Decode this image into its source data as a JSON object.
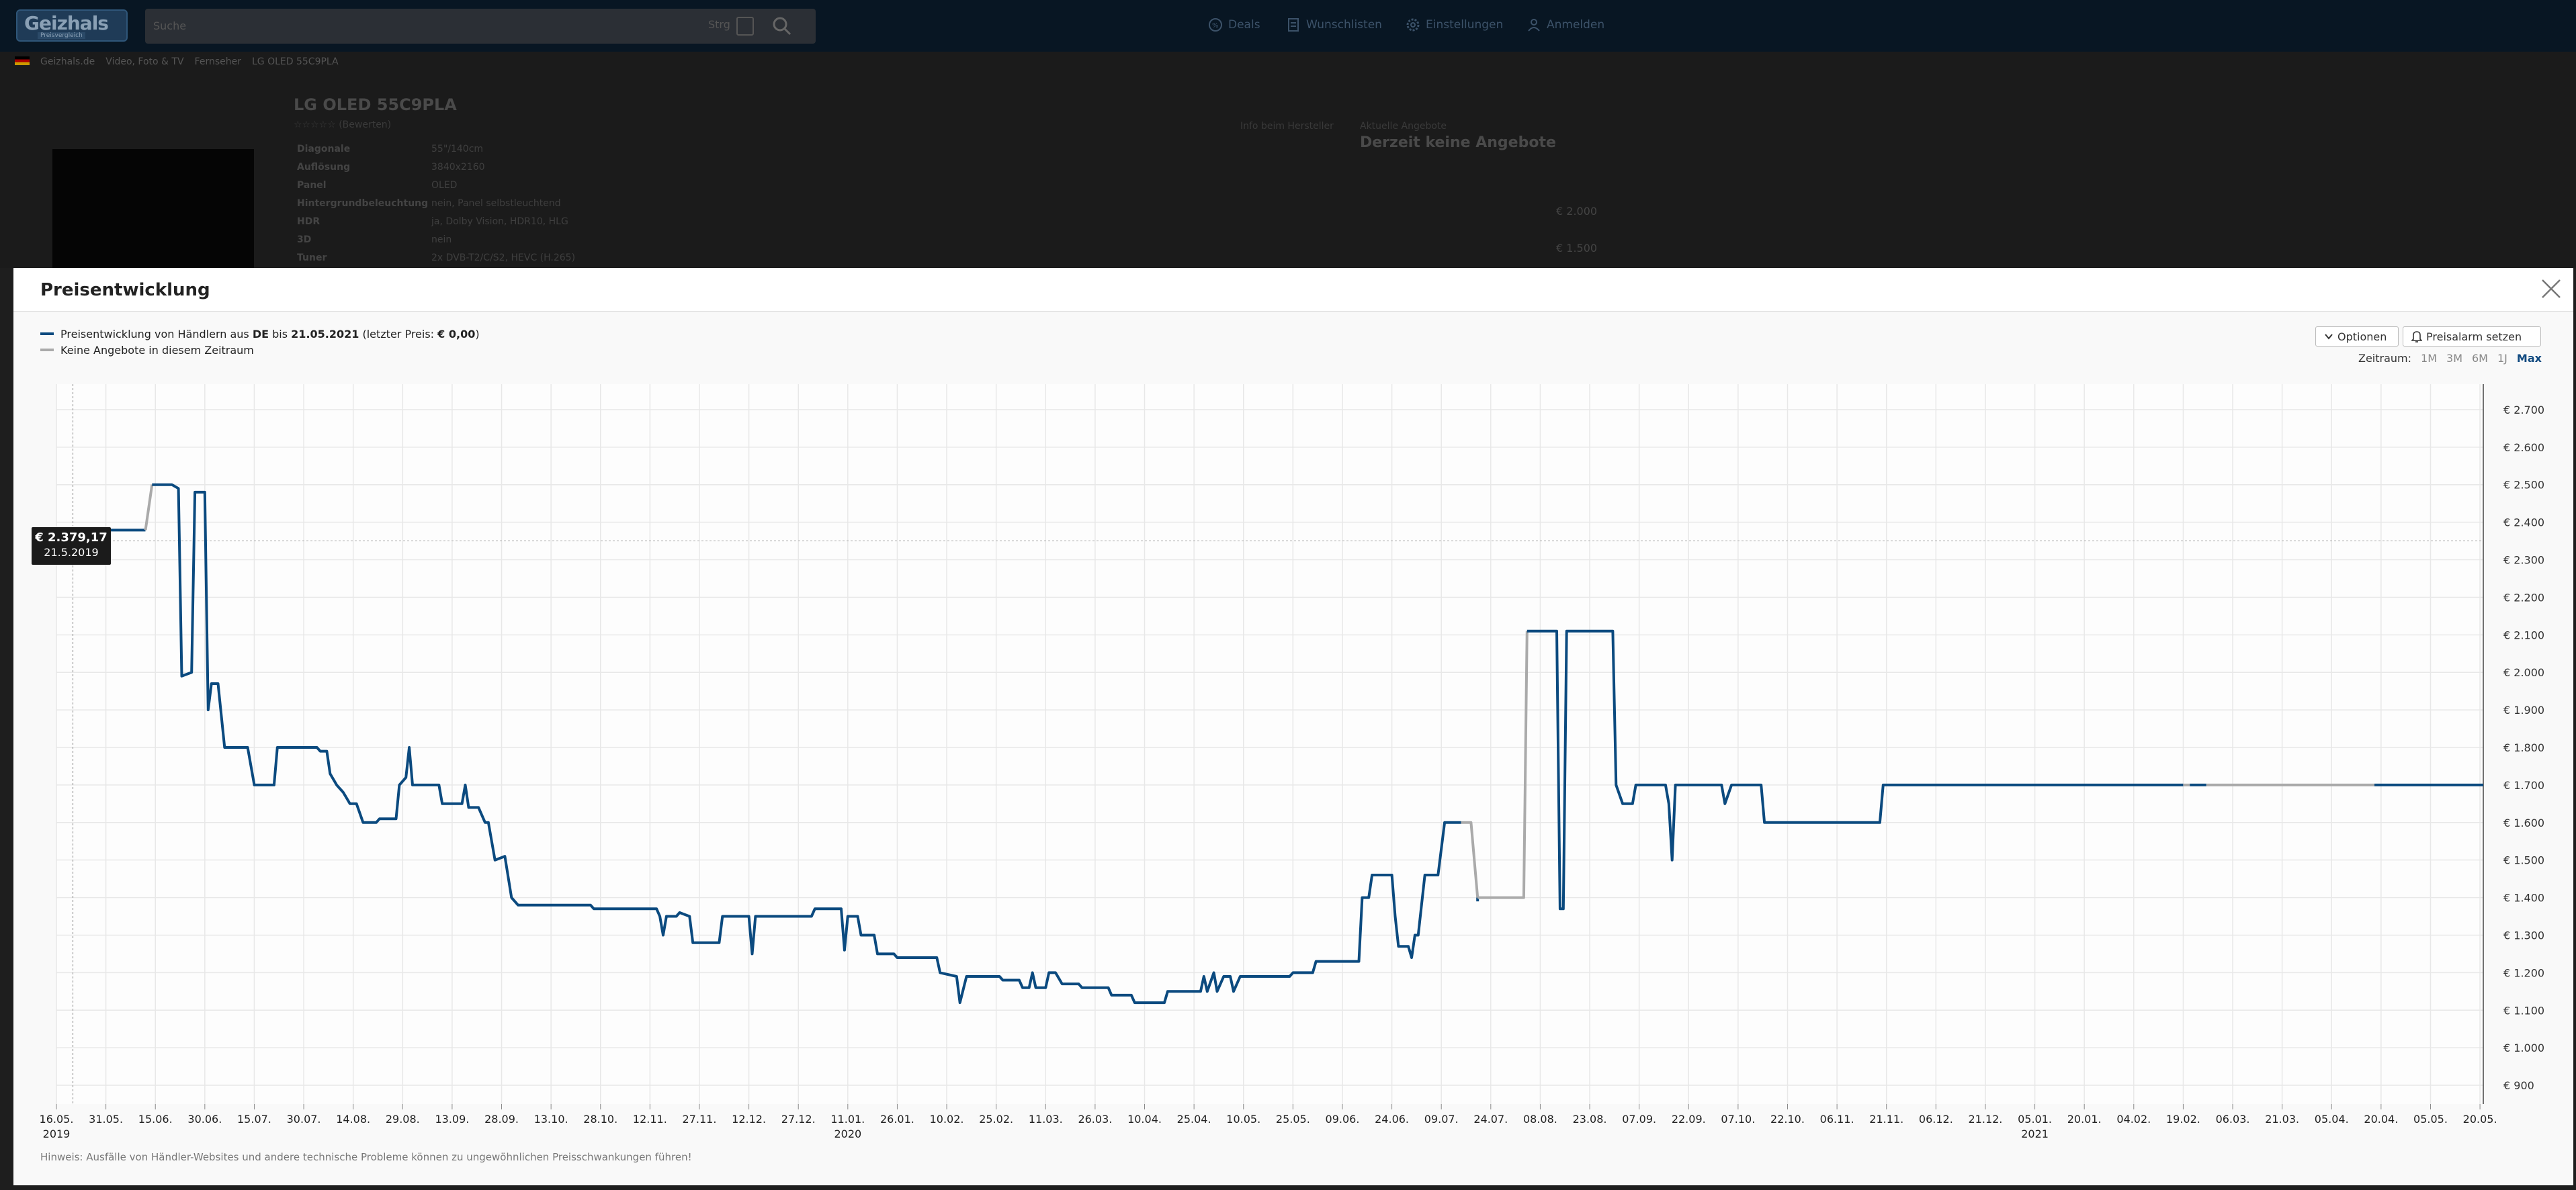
{
  "header": {
    "logo_text": "Geizhals",
    "logo_sub": "Preisvergleich",
    "search_placeholder": "Suche",
    "search_key": "Strg",
    "nav": [
      {
        "label": "Deals",
        "icon": "deals-icon"
      },
      {
        "label": "Wunschlisten",
        "icon": "list-icon"
      },
      {
        "label": "Einstellungen",
        "icon": "gear-icon"
      },
      {
        "label": "Anmelden",
        "icon": "user-icon"
      }
    ]
  },
  "breadcrumb": [
    "Geizhals.de",
    "Video, Foto & TV",
    "Fernseher",
    "LG OLED 55C9PLA"
  ],
  "product": {
    "title": "LG OLED 55C9PLA",
    "rating_text": "☆☆☆☆☆ (Bewerten)",
    "specs": [
      {
        "k": "Diagonale",
        "v": "55\"/140cm"
      },
      {
        "k": "Auflösung",
        "v": "3840x2160"
      },
      {
        "k": "Panel",
        "v": "OLED"
      },
      {
        "k": "Hintergrundbeleuchtung",
        "v": "nein, Panel selbstleuchtend"
      },
      {
        "k": "HDR",
        "v": "ja, Dolby Vision, HDR10, HLG"
      },
      {
        "k": "3D",
        "v": "nein"
      },
      {
        "k": "Tuner",
        "v": "2x DVB-T2/C/S2, HEVC (H.265)"
      }
    ],
    "maker_link": "Info beim Hersteller",
    "offer_label": "Aktuelle Angebote",
    "offer_title": "Derzeit keine Angebote",
    "offer_prices": [
      "€ 2.000",
      "€ 1.500"
    ]
  },
  "modal": {
    "title": "Preisentwicklung",
    "legend": [
      {
        "prefix": "Preisentwicklung von Händlern aus ",
        "country": "DE",
        "mid": " bis ",
        "date": "21.05.2021",
        "suffix_a": " (letzter Preis: ",
        "last_price": "€ 0,00",
        "suffix_b": ")",
        "color": "#0b4a7f"
      },
      {
        "text": "Keine Angebote in diesem Zeitraum",
        "color": "#aaaaaa"
      }
    ],
    "options_label": "Optionen",
    "alarm_label": "Preisalarm setzen",
    "range_label": "Zeitraum:",
    "ranges": [
      "1M",
      "3M",
      "6M",
      "1J",
      "Max"
    ],
    "active_range": "Max",
    "tooltip": {
      "value": "€ 2.379,17",
      "date": "21.5.2019"
    },
    "hint": "Hinweis: Ausfälle von Händler-Websites und andere technische Probleme können zu ungewöhnlichen Preisschwankungen führen!"
  },
  "chart_data": {
    "type": "line",
    "title": "",
    "xlabel": "",
    "ylabel": "",
    "ylim": [
      850,
      2750
    ],
    "y_ticks": [
      "€ 900",
      "€ 1.000",
      "€ 1.100",
      "€ 1.200",
      "€ 1.300",
      "€ 1.400",
      "€ 1.500",
      "€ 1.600",
      "€ 1.700",
      "€ 1.800",
      "€ 1.900",
      "€ 2.000",
      "€ 2.100",
      "€ 2.200",
      "€ 2.300",
      "€ 2.400",
      "€ 2.500",
      "€ 2.600",
      "€ 2.700"
    ],
    "y_tick_values": [
      900,
      1000,
      1100,
      1200,
      1300,
      1400,
      1500,
      1600,
      1700,
      1800,
      1900,
      2000,
      2100,
      2200,
      2300,
      2400,
      2500,
      2600,
      2700
    ],
    "x_ticks": [
      "16.05.",
      "31.05.",
      "15.06.",
      "30.06.",
      "15.07.",
      "30.07.",
      "14.08.",
      "29.08.",
      "13.09.",
      "28.09.",
      "13.10.",
      "28.10.",
      "12.11.",
      "27.11.",
      "12.12.",
      "27.12.",
      "11.01.",
      "26.01.",
      "10.02.",
      "25.02.",
      "11.03.",
      "26.03.",
      "10.04.",
      "25.04.",
      "10.05.",
      "25.05.",
      "09.06.",
      "24.06.",
      "09.07.",
      "24.07.",
      "08.08.",
      "23.08.",
      "07.09.",
      "22.09.",
      "07.10.",
      "22.10.",
      "06.11.",
      "21.11.",
      "06.12.",
      "21.12.",
      "05.01.",
      "20.01.",
      "04.02.",
      "19.02.",
      "06.03.",
      "21.03.",
      "05.04.",
      "20.04.",
      "05.05.",
      "20.05."
    ],
    "x_tick_years": {
      "0": "2019",
      "16": "2020",
      "40": "2021"
    },
    "x_start": "2019-05-16",
    "x_end": "2021-05-21",
    "series": [
      {
        "color": "#0b4a7f",
        "points": [
          [
            "2019-05-16",
            2379
          ],
          [
            "2019-06-12",
            2379
          ]
        ]
      },
      {
        "color": "#aaaaaa",
        "points": [
          [
            "2019-06-12",
            2379
          ],
          [
            "2019-06-14",
            2500
          ]
        ]
      },
      {
        "color": "#0b4a7f",
        "points": [
          [
            "2019-06-14",
            2500
          ],
          [
            "2019-06-20",
            2500
          ],
          [
            "2019-06-22",
            2490
          ],
          [
            "2019-06-23",
            1990
          ],
          [
            "2019-06-26",
            2000
          ],
          [
            "2019-06-27",
            2480
          ],
          [
            "2019-06-30",
            2480
          ],
          [
            "2019-07-01",
            1900
          ],
          [
            "2019-07-02",
            1970
          ],
          [
            "2019-07-04",
            1970
          ],
          [
            "2019-07-06",
            1800
          ],
          [
            "2019-07-13",
            1800
          ],
          [
            "2019-07-15",
            1700
          ],
          [
            "2019-07-21",
            1700
          ],
          [
            "2019-07-22",
            1800
          ],
          [
            "2019-08-03",
            1800
          ],
          [
            "2019-08-04",
            1790
          ],
          [
            "2019-08-06",
            1790
          ],
          [
            "2019-08-07",
            1730
          ],
          [
            "2019-08-09",
            1700
          ],
          [
            "2019-08-11",
            1680
          ],
          [
            "2019-08-13",
            1650
          ],
          [
            "2019-08-15",
            1650
          ],
          [
            "2019-08-17",
            1600
          ],
          [
            "2019-08-21",
            1600
          ],
          [
            "2019-08-22",
            1610
          ],
          [
            "2019-08-27",
            1610
          ],
          [
            "2019-08-28",
            1700
          ],
          [
            "2019-08-30",
            1720
          ],
          [
            "2019-08-31",
            1800
          ],
          [
            "2019-09-01",
            1700
          ],
          [
            "2019-09-09",
            1700
          ],
          [
            "2019-09-10",
            1650
          ],
          [
            "2019-09-16",
            1650
          ],
          [
            "2019-09-17",
            1700
          ],
          [
            "2019-09-18",
            1640
          ],
          [
            "2019-09-21",
            1640
          ],
          [
            "2019-09-23",
            1600
          ],
          [
            "2019-09-24",
            1600
          ],
          [
            "2019-09-26",
            1500
          ],
          [
            "2019-09-29",
            1510
          ],
          [
            "2019-10-01",
            1400
          ],
          [
            "2019-10-03",
            1380
          ],
          [
            "2019-10-25",
            1380
          ],
          [
            "2019-10-26",
            1370
          ],
          [
            "2019-11-14",
            1370
          ],
          [
            "2019-11-15",
            1350
          ],
          [
            "2019-11-16",
            1300
          ],
          [
            "2019-11-17",
            1350
          ],
          [
            "2019-11-20",
            1350
          ],
          [
            "2019-11-21",
            1360
          ],
          [
            "2019-11-24",
            1350
          ],
          [
            "2019-11-25",
            1280
          ],
          [
            "2019-12-03",
            1280
          ],
          [
            "2019-12-04",
            1350
          ],
          [
            "2019-12-12",
            1350
          ],
          [
            "2019-12-13",
            1250
          ],
          [
            "2019-12-14",
            1350
          ],
          [
            "2019-12-31",
            1350
          ],
          [
            "2020-01-01",
            1370
          ],
          [
            "2020-01-09",
            1370
          ],
          [
            "2020-01-10",
            1260
          ],
          [
            "2020-01-11",
            1350
          ],
          [
            "2020-01-14",
            1350
          ],
          [
            "2020-01-15",
            1300
          ],
          [
            "2020-01-19",
            1300
          ],
          [
            "2020-01-20",
            1250
          ],
          [
            "2020-01-25",
            1250
          ],
          [
            "2020-01-26",
            1240
          ],
          [
            "2020-02-07",
            1240
          ],
          [
            "2020-02-08",
            1200
          ],
          [
            "2020-02-13",
            1190
          ],
          [
            "2020-02-14",
            1120
          ],
          [
            "2020-02-16",
            1190
          ],
          [
            "2020-02-26",
            1190
          ],
          [
            "2020-02-27",
            1180
          ],
          [
            "2020-03-03",
            1180
          ],
          [
            "2020-03-04",
            1160
          ],
          [
            "2020-03-06",
            1160
          ],
          [
            "2020-03-07",
            1200
          ],
          [
            "2020-03-08",
            1160
          ],
          [
            "2020-03-11",
            1160
          ],
          [
            "2020-03-12",
            1200
          ],
          [
            "2020-03-14",
            1200
          ],
          [
            "2020-03-16",
            1170
          ],
          [
            "2020-03-21",
            1170
          ],
          [
            "2020-03-22",
            1160
          ],
          [
            "2020-03-30",
            1160
          ],
          [
            "2020-03-31",
            1140
          ],
          [
            "2020-04-06",
            1140
          ],
          [
            "2020-04-07",
            1120
          ],
          [
            "2020-04-16",
            1120
          ],
          [
            "2020-04-17",
            1150
          ],
          [
            "2020-04-27",
            1150
          ],
          [
            "2020-04-28",
            1190
          ],
          [
            "2020-04-29",
            1150
          ],
          [
            "2020-05-01",
            1200
          ],
          [
            "2020-05-02",
            1150
          ],
          [
            "2020-05-04",
            1190
          ],
          [
            "2020-05-06",
            1190
          ],
          [
            "2020-05-07",
            1150
          ],
          [
            "2020-05-09",
            1190
          ],
          [
            "2020-05-24",
            1190
          ],
          [
            "2020-05-25",
            1200
          ],
          [
            "2020-05-31",
            1200
          ],
          [
            "2020-06-01",
            1230
          ],
          [
            "2020-06-14",
            1230
          ],
          [
            "2020-06-15",
            1400
          ],
          [
            "2020-06-17",
            1400
          ],
          [
            "2020-06-18",
            1460
          ],
          [
            "2020-06-24",
            1460
          ],
          [
            "2020-06-25",
            1350
          ],
          [
            "2020-06-26",
            1270
          ],
          [
            "2020-06-29",
            1270
          ],
          [
            "2020-06-30",
            1240
          ],
          [
            "2020-07-01",
            1300
          ],
          [
            "2020-07-02",
            1300
          ],
          [
            "2020-07-04",
            1460
          ],
          [
            "2020-07-08",
            1460
          ],
          [
            "2020-07-10",
            1600
          ],
          [
            "2020-07-15",
            1600
          ]
        ]
      },
      {
        "color": "#aaaaaa",
        "points": [
          [
            "2020-07-15",
            1600
          ],
          [
            "2020-07-18",
            1600
          ],
          [
            "2020-07-20",
            1400
          ]
        ]
      },
      {
        "color": "#0b4a7f",
        "points": [
          [
            "2020-07-20",
            1400
          ],
          [
            "2020-07-20",
            1390
          ]
        ]
      },
      {
        "color": "#aaaaaa",
        "points": [
          [
            "2020-07-20",
            1400
          ],
          [
            "2020-08-03",
            1400
          ],
          [
            "2020-08-04",
            2110
          ]
        ]
      },
      {
        "color": "#0b4a7f",
        "points": [
          [
            "2020-08-04",
            2110
          ],
          [
            "2020-08-13",
            2110
          ],
          [
            "2020-08-14",
            1370
          ],
          [
            "2020-08-15",
            1370
          ],
          [
            "2020-08-16",
            2110
          ],
          [
            "2020-08-30",
            2110
          ],
          [
            "2020-08-31",
            1700
          ],
          [
            "2020-09-02",
            1650
          ],
          [
            "2020-09-05",
            1650
          ],
          [
            "2020-09-06",
            1700
          ],
          [
            "2020-09-15",
            1700
          ],
          [
            "2020-09-16",
            1650
          ],
          [
            "2020-09-17",
            1500
          ],
          [
            "2020-09-18",
            1700
          ],
          [
            "2020-10-02",
            1700
          ],
          [
            "2020-10-03",
            1650
          ],
          [
            "2020-10-05",
            1700
          ],
          [
            "2020-10-14",
            1700
          ],
          [
            "2020-10-15",
            1600
          ],
          [
            "2020-11-19",
            1600
          ],
          [
            "2020-11-20",
            1700
          ],
          [
            "2021-02-19",
            1700
          ]
        ]
      },
      {
        "color": "#aaaaaa",
        "points": [
          [
            "2021-02-19",
            1700
          ],
          [
            "2021-02-21",
            1700
          ]
        ]
      },
      {
        "color": "#0b4a7f",
        "points": [
          [
            "2021-02-21",
            1700
          ],
          [
            "2021-02-26",
            1700
          ]
        ]
      },
      {
        "color": "#aaaaaa",
        "points": [
          [
            "2021-02-26",
            1700
          ],
          [
            "2021-04-18",
            1700
          ]
        ]
      },
      {
        "color": "#0b4a7f",
        "points": [
          [
            "2021-04-18",
            1700
          ],
          [
            "2021-05-21",
            1700
          ]
        ]
      }
    ],
    "grid": true,
    "y_axis_position": "right",
    "hover_marker": {
      "date": "2019-05-21",
      "value": 2379.17
    }
  }
}
